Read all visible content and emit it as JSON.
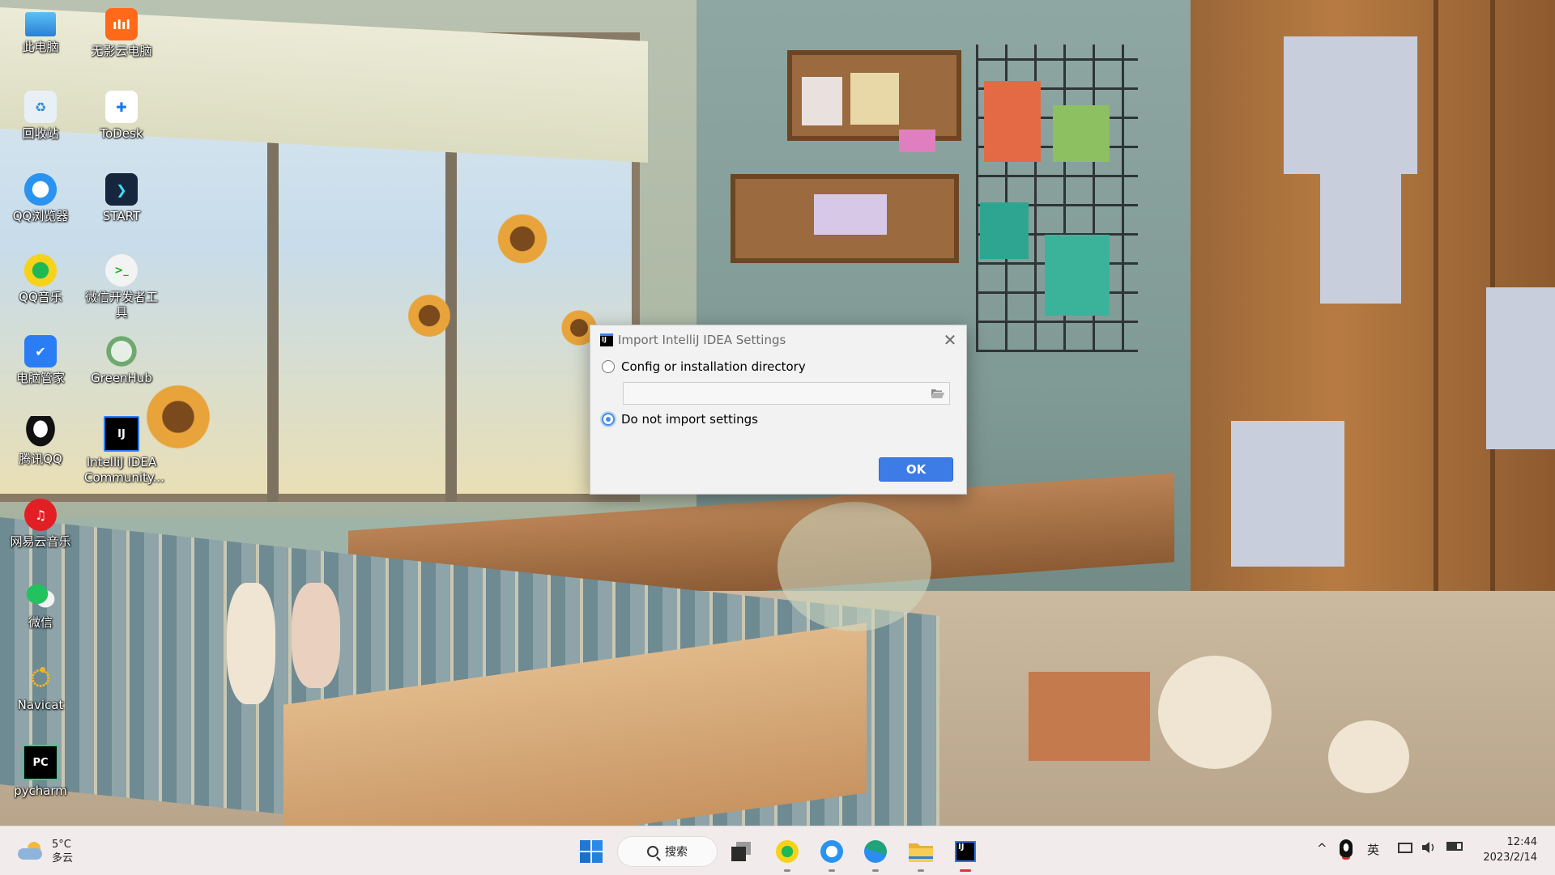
{
  "desktop": {
    "icons": [
      {
        "label": "此电脑",
        "icon": "computer-icon"
      },
      {
        "label": "无影云电脑",
        "icon": "wuying-cloud-icon"
      },
      {
        "label": "回收站",
        "icon": "recycle-bin-icon"
      },
      {
        "label": "ToDesk",
        "icon": "todesk-icon"
      },
      {
        "label": "QQ浏览器",
        "icon": "qq-browser-icon"
      },
      {
        "label": "START",
        "icon": "start-app-icon"
      },
      {
        "label": "QQ音乐",
        "icon": "qq-music-icon"
      },
      {
        "label": "微信开发者工具",
        "icon": "wechat-devtools-icon"
      },
      {
        "label": "电脑管家",
        "icon": "pc-manager-icon"
      },
      {
        "label": "GreenHub",
        "icon": "greenhub-icon"
      },
      {
        "label": "腾讯QQ",
        "icon": "qq-icon"
      },
      {
        "label": "IntelliJ IDEA Community...",
        "icon": "intellij-icon"
      },
      {
        "label": "网易云音乐",
        "icon": "netease-music-icon"
      },
      {
        "label": "微信",
        "icon": "wechat-icon"
      },
      {
        "label": "Navicat",
        "icon": "navicat-icon"
      },
      {
        "label": "pycharm",
        "icon": "pycharm-icon"
      }
    ]
  },
  "dialog": {
    "title": "Import IntelliJ IDEA Settings",
    "logo_text": "IJ",
    "close_glyph": "✕",
    "option_config": "Config or installation directory",
    "option_config_selected": false,
    "directory_value": "",
    "option_no_import": "Do not import settings",
    "option_no_import_selected": true,
    "ok_label": "OK"
  },
  "taskbar": {
    "weather_temp": "5°C",
    "weather_desc": "多云",
    "search_label": "搜索",
    "tray_language": "英",
    "tray_chevron": "^",
    "time": "12:44",
    "date": "2023/2/14"
  },
  "colors": {
    "dialog_accent": "#3d7ce6",
    "taskbar_bg": "#f1eceb"
  }
}
